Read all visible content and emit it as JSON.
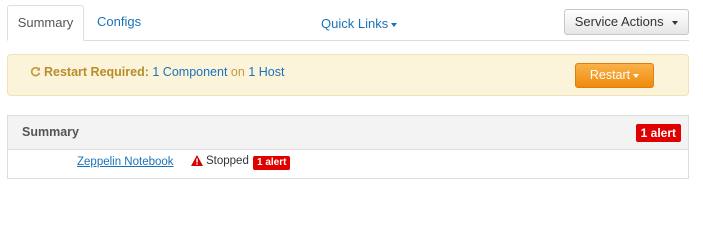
{
  "tabs": {
    "summary_label": "Summary",
    "configs_label": "Configs"
  },
  "quick_links": {
    "label": "Quick Links"
  },
  "service_actions": {
    "label": "Service Actions"
  },
  "restart_banner": {
    "prefix": "Restart Required:",
    "component_link": "1 Component",
    "on_text": "on",
    "host_link": "1 Host",
    "button_label": "Restart"
  },
  "summary_panel": {
    "title": "Summary",
    "alert_badge": "1 alert",
    "row": {
      "component": "Zeppelin Notebook",
      "status": "Stopped",
      "alert_badge": "1 alert"
    }
  },
  "colors": {
    "link": "#1a73b8",
    "alert_red": "#e10000",
    "restart_orange": "#f08a0b",
    "banner_bg": "#fcf3db",
    "warning_red": "#d40000"
  },
  "icons": {
    "refresh": "refresh-icon",
    "caret": "caret-down-icon",
    "warning": "warning-icon"
  }
}
